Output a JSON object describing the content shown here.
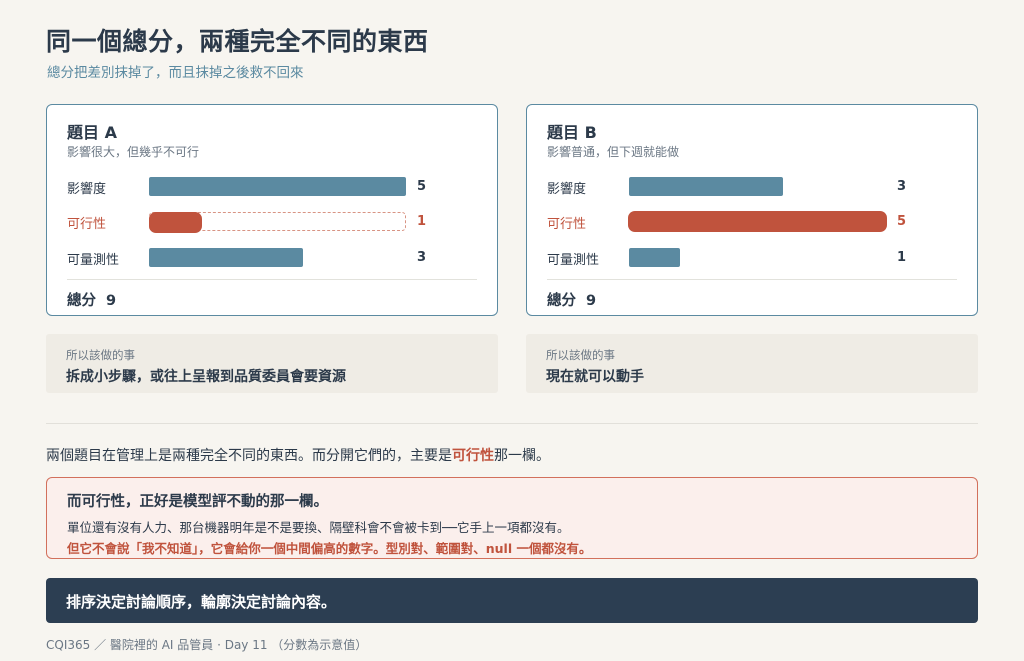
{
  "page": {
    "title": "同一個總分，兩種完全不同的東西",
    "subtitle": "總分把差別抹掉了，而且抹掉之後救不回來"
  },
  "cards": [
    {
      "title": "題目 A",
      "desc": "影響很大，但幾乎不可行",
      "rows": [
        {
          "label": "影響度",
          "value": "5",
          "fraction": 1.0
        },
        {
          "label": "可行性",
          "value": "1",
          "fraction": 0.2
        },
        {
          "label": "可量測性",
          "value": "3",
          "fraction": 0.6
        }
      ],
      "total_label": "總分",
      "total_value": "9"
    },
    {
      "title": "題目 B",
      "desc": "影響普通，但下週就能做",
      "rows": [
        {
          "label": "影響度",
          "value": "3",
          "fraction": 0.6
        },
        {
          "label": "可行性",
          "value": "5",
          "fraction": 1.0
        },
        {
          "label": "可量測性",
          "value": "1",
          "fraction": 0.2
        }
      ],
      "total_label": "總分",
      "total_value": "9"
    }
  ],
  "notes": [
    {
      "label": "所以該做的事",
      "text": "拆成小步驟，或往上呈報到品質委員會要資源"
    },
    {
      "label": "所以該做的事",
      "text": "現在就可以動手"
    }
  ],
  "paragraph": {
    "before": "兩個題目在管理上是兩種完全不同的東西。而分開它們的，主要是",
    "highlight": "可行性",
    "after": "那一欄。"
  },
  "callout": {
    "title": "而可行性，正好是模型評不動的那一欄。",
    "line1": "單位還有沒有人力、那台機器明年是不是要換、隔壁科會不會被卡到──它手上一項都沒有。",
    "line2": "但它不會說「我不知道」，它會給你一個中間偏高的數字。型別對、範圍對、null 一個都沒有。"
  },
  "banner": {
    "text": "排序決定討論順序，輪廓決定討論內容。"
  },
  "footer": {
    "text": "CQI365 ／ 醫院裡的 AI 品管員 · Day 11 （分數為示意值）"
  },
  "colors": {
    "accent_blue": "#5b8aa1",
    "accent_red": "#c0533d",
    "navy": "#2c3e52"
  }
}
